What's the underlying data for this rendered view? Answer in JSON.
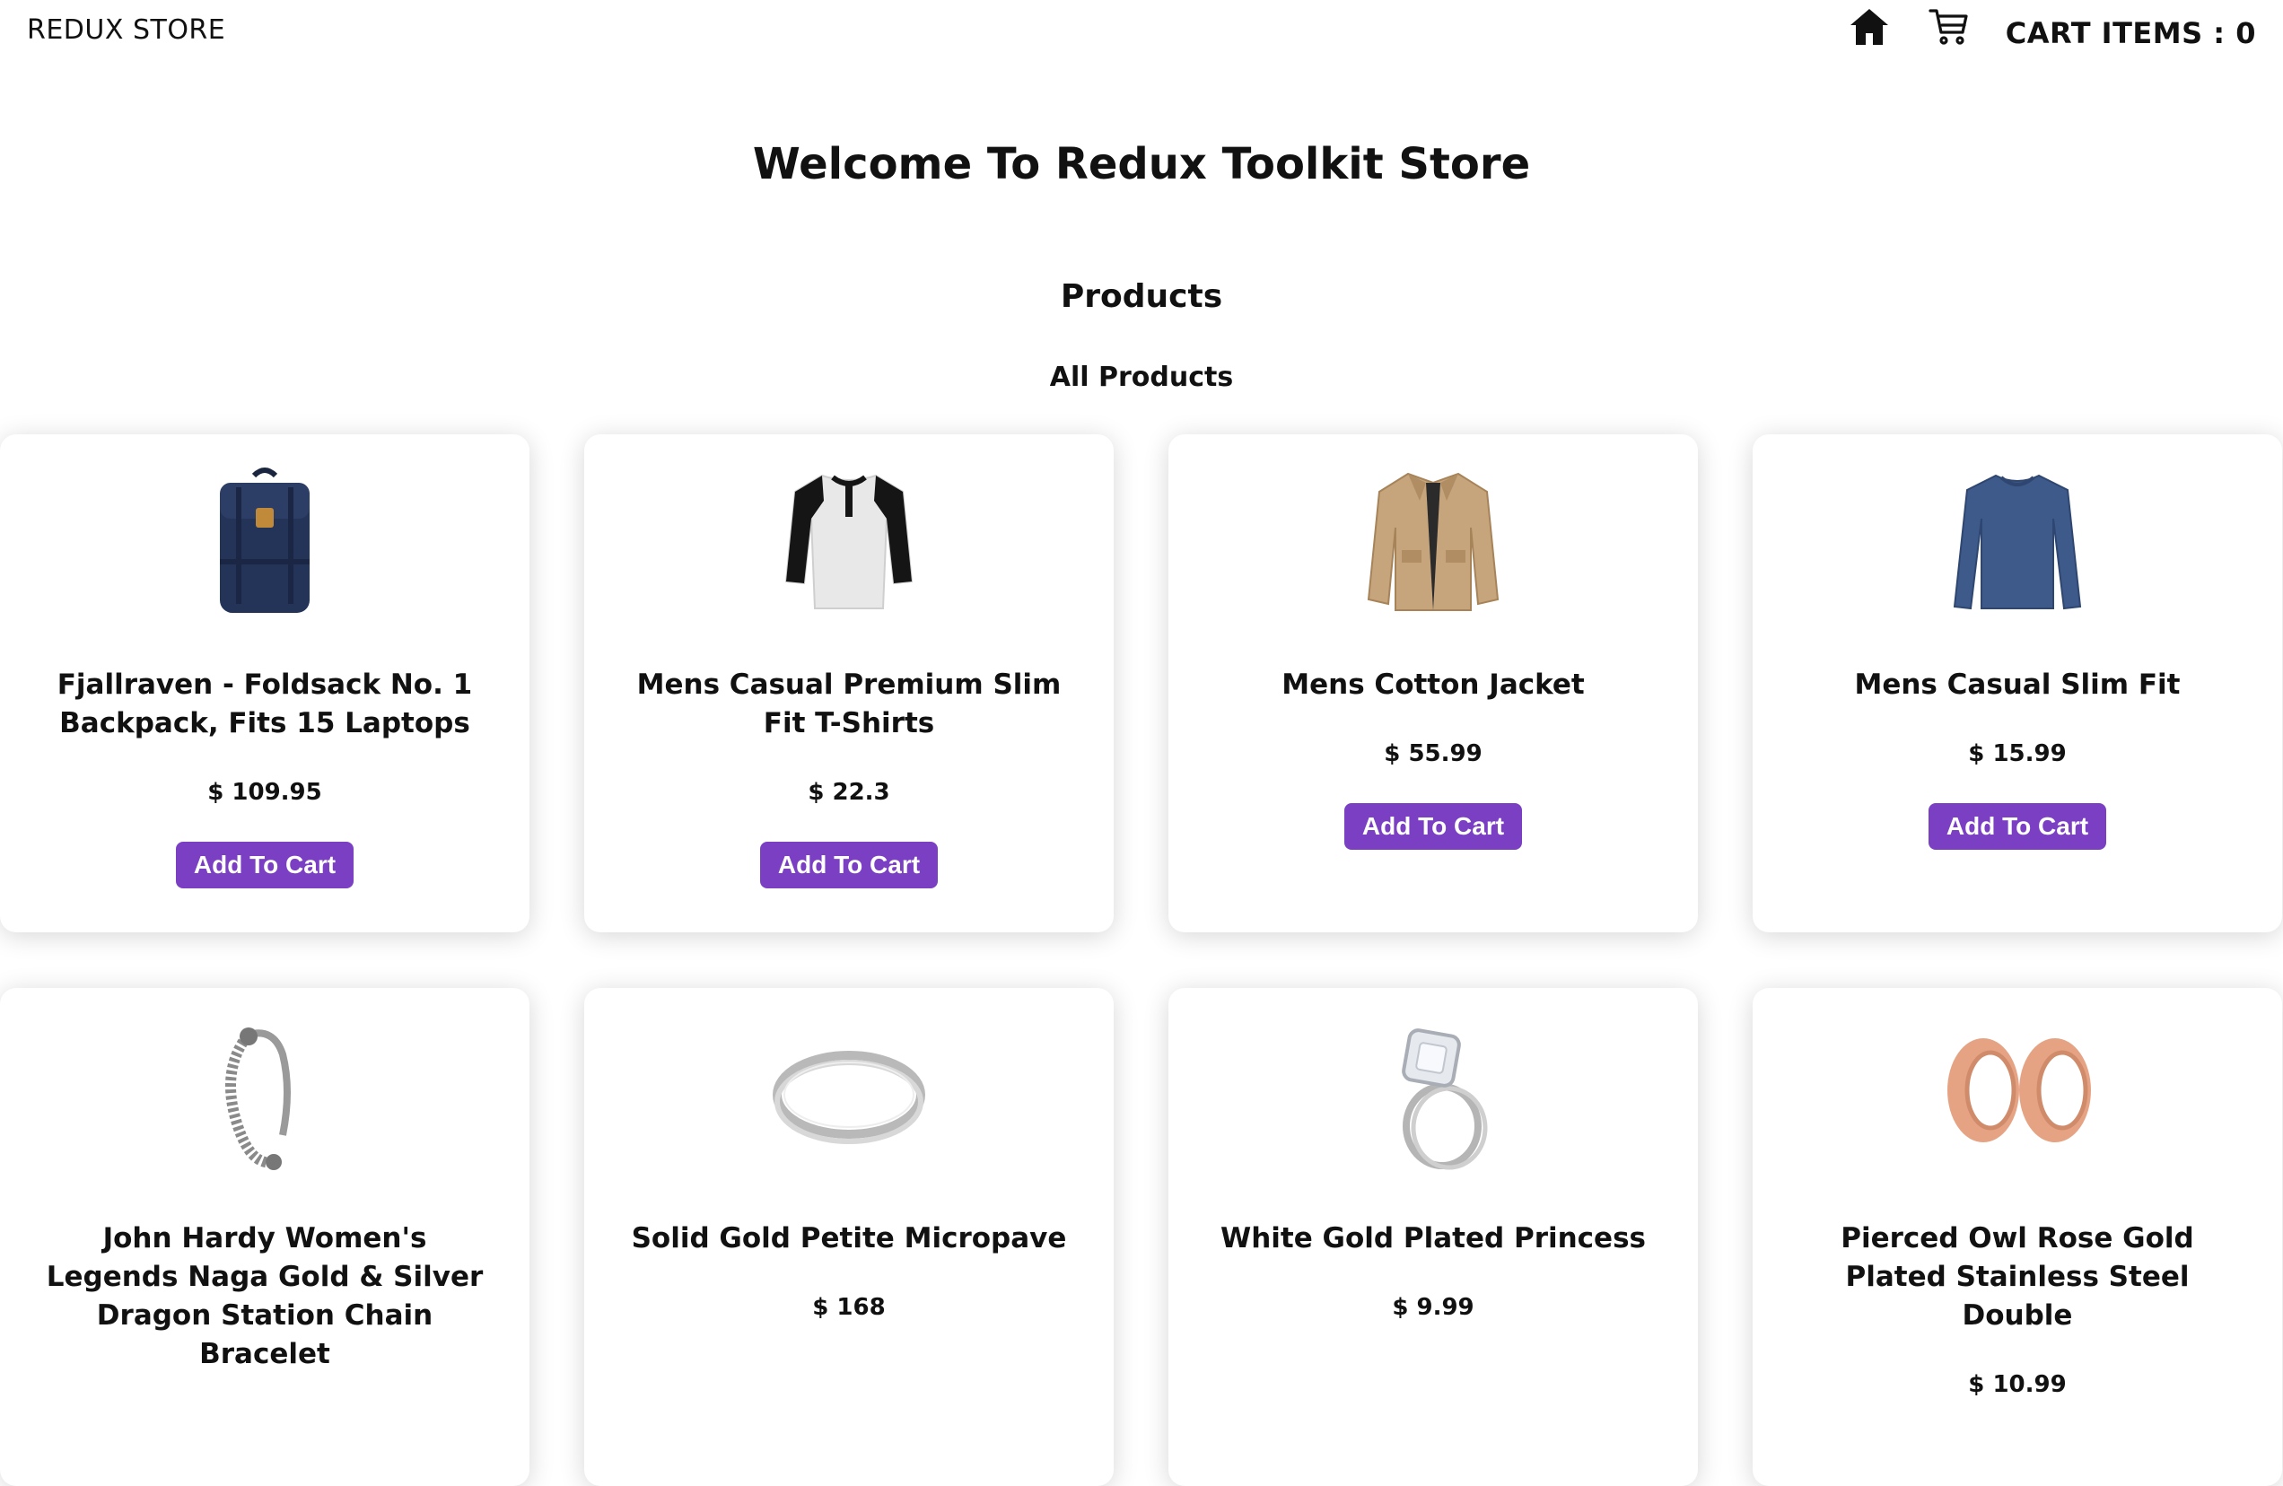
{
  "navbar": {
    "brand": "REDUX STORE",
    "home_icon": "home-icon",
    "cart_icon": "cart-icon",
    "cart_items_label": "CART ITEMS : 0"
  },
  "header": {
    "welcome": "Welcome To Redux Toolkit Store",
    "section_title": "Products",
    "section_subtitle": "All Products"
  },
  "colors": {
    "button_bg": "#7b3fc4",
    "button_text": "#ffffff"
  },
  "products": [
    {
      "title": "Fjallraven - Foldsack No. 1 Backpack, Fits 15 Laptops",
      "price": "$ 109.95",
      "button": "Add To Cart",
      "image": "backpack"
    },
    {
      "title": "Mens Casual Premium Slim Fit T-Shirts",
      "price": "$ 22.3",
      "button": "Add To Cart",
      "image": "raglan-shirt"
    },
    {
      "title": "Mens Cotton Jacket",
      "price": "$ 55.99",
      "button": "Add To Cart",
      "image": "jacket"
    },
    {
      "title": "Mens Casual Slim Fit",
      "price": "$ 15.99",
      "button": "Add To Cart",
      "image": "long-sleeve-shirt"
    },
    {
      "title": "John Hardy Women's Legends Naga Gold & Silver Dragon Station Chain Bracelet",
      "price": "",
      "button": "",
      "image": "bracelet"
    },
    {
      "title": "Solid Gold Petite Micropave",
      "price": "$ 168",
      "button": "",
      "image": "ring"
    },
    {
      "title": "White Gold Plated Princess",
      "price": "$ 9.99",
      "button": "",
      "image": "engagement-ring"
    },
    {
      "title": "Pierced Owl Rose Gold Plated Stainless Steel Double",
      "price": "$ 10.99",
      "button": "",
      "image": "ear-plugs"
    }
  ]
}
